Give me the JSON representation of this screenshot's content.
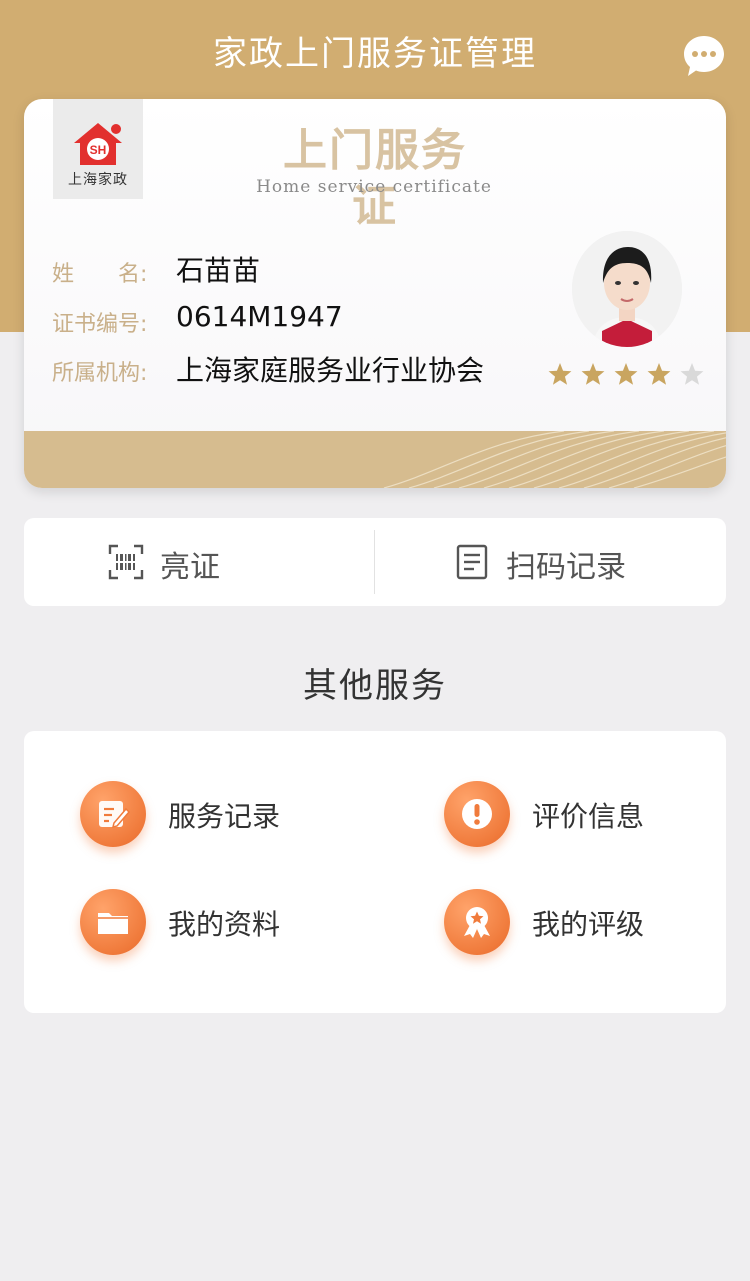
{
  "header": {
    "title": "家政上门服务证管理",
    "chat_icon": "chat-bubble-icon"
  },
  "certificate": {
    "logo_mark": "SH",
    "logo_text": "上海家政",
    "title": "上门服务证",
    "subtitle": "Home service certificate",
    "fields": [
      {
        "label": "姓　　名:",
        "value": "石苗苗"
      },
      {
        "label": "证书编号:",
        "value": "0614M1947"
      },
      {
        "label": "所属机构:",
        "value": "上海家庭服务业行业协会"
      }
    ],
    "rating": {
      "value": 4,
      "max": 5
    },
    "colors": {
      "accent": "#d1ad71",
      "star_on": "#c9a560",
      "star_off": "#d9d9d9"
    }
  },
  "actions": [
    {
      "label": "亮证",
      "icon": "barcode-scan-icon"
    },
    {
      "label": "扫码记录",
      "icon": "document-list-icon"
    }
  ],
  "other_services": {
    "title": "其他服务",
    "items": [
      {
        "label": "服务记录",
        "icon": "edit-note-icon"
      },
      {
        "label": "评价信息",
        "icon": "exclamation-icon"
      },
      {
        "label": "我的资料",
        "icon": "folder-icon"
      },
      {
        "label": "我的评级",
        "icon": "award-badge-icon"
      }
    ],
    "colors": {
      "icon_bg": "#f07b3c"
    }
  }
}
